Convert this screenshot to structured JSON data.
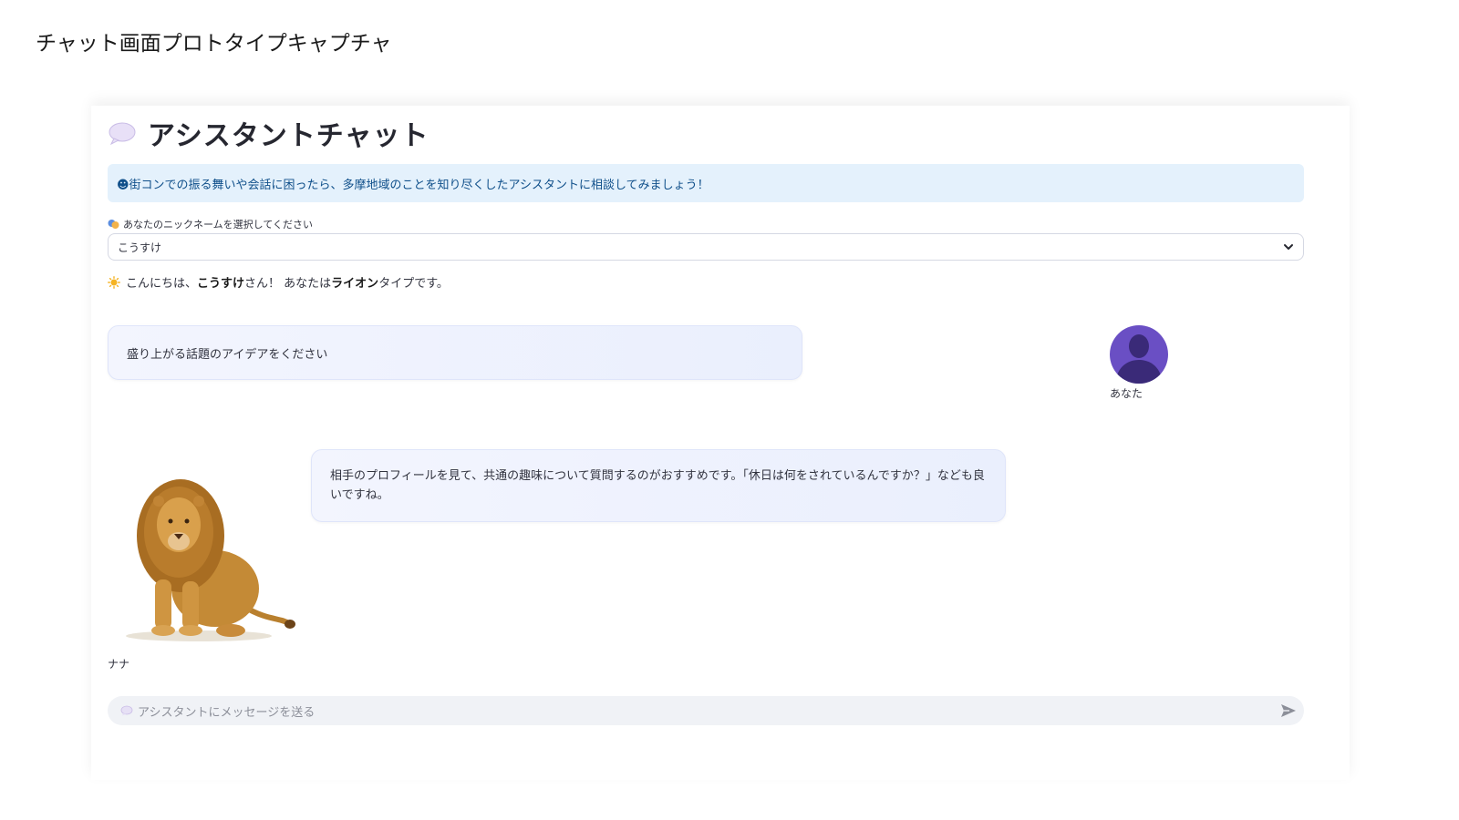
{
  "page": {
    "caption": "チャット画面プロトタイプキャプチャ"
  },
  "header": {
    "icon": "speech-bubble-icon",
    "title": "アシスタントチャット"
  },
  "info_banner": {
    "text": "☻街コンでの振る舞いや会話に困ったら、多摩地域のことを知り尽くしたアシスタントに相談してみましょう！"
  },
  "nickname_select": {
    "label_icon": "theater-masks-icon",
    "label": "あなたのニックネームを選択してください",
    "selected": "こうすけ"
  },
  "greeting": {
    "icon": "sun-icon",
    "prefix": "こんにちは、",
    "name": "こうすけ",
    "middle": "さん！ あなたは ",
    "type": "ライオン",
    "suffix": " タイプです。"
  },
  "messages": [
    {
      "role": "user",
      "sender": "あなた",
      "text": "盛り上がる話題のアイデアをください"
    },
    {
      "role": "assistant",
      "sender": "ナナ",
      "text": "相手のプロフィールを見て、共通の趣味について質問するのがおすすめです。「休日は何をされているんですか？」なども良いですね。"
    }
  ],
  "chat_input": {
    "placeholder": "アシスタントにメッセージを送る"
  },
  "colors": {
    "banner_bg": "#e4f1fc",
    "banner_text": "#0f4f8a",
    "bubble_bg": "#eef2fd",
    "user_avatar": "#5b3fb0"
  }
}
